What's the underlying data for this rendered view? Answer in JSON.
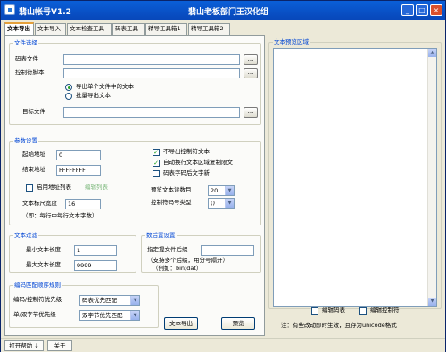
{
  "window": {
    "title": "翡山帐号V1.2",
    "subtitle": "翡山老板部门王汉化组"
  },
  "tabs": [
    {
      "label": "文本导出"
    },
    {
      "label": "文本导入"
    },
    {
      "label": "文本检查工具"
    },
    {
      "label": "码表工具"
    },
    {
      "label": "精导工具箱1"
    },
    {
      "label": "精导工具箱2"
    }
  ],
  "text_select": {
    "legend": "文件选择",
    "codetable_label": "码表文件",
    "codetable_value": "",
    "control_label": "控制符脚本",
    "control_value": "",
    "radio_single": "导出单个文件中的文本",
    "radio_batch": "批量导出文本",
    "target_label": "目标文件",
    "target_value": "",
    "browse": "..."
  },
  "params": {
    "legend": "参数设置",
    "start_label": "起始地址",
    "start_value": "0",
    "end_label": "结束地址",
    "end_value": "FFFFFFFF",
    "addr_list_label": "启用地址列表",
    "addr_list_link": "编辑列表",
    "max_len_label": "文本标尺宽度",
    "max_len_value": "16",
    "max_len_note": "（即：每行中每行文本字数）",
    "chk_control_label": "不导出控制符文本",
    "chk_control_checked": true,
    "chk_autowrap_label": "自动换行文本区域复制限文",
    "chk_autowrap_checked": true,
    "chk_encoding_label": "码表字码后文字新",
    "chk_encoding_checked": false,
    "preview_count_label": "预览文本读数目",
    "preview_count_value": "20",
    "control_type_label": "控制符码号类型",
    "control_type_value": "()"
  },
  "text_filter": {
    "legend": "文本过滤",
    "min_len_label": "最小文本长度",
    "min_len_value": "1",
    "max_len_label": "最大文本长度",
    "max_len_value": "9999"
  },
  "postprocess": {
    "legend": "数后置设置",
    "ext_label": "指定提文件后缀",
    "ext_value": "",
    "ext_hint": "（支持多个后缀，用分号隔开）",
    "ext_example": "（例如：bin;dat）"
  },
  "priority": {
    "legend": "编码匹配顺序规则",
    "row1_label": "编码/控制符优先级",
    "row1_value": "码表优先匹配",
    "row2_label": "单/双字节优先级",
    "row2_value": "双字节优先匹配"
  },
  "actions": {
    "export": "文本导出",
    "preview": "预览"
  },
  "right": {
    "legend": "文本预览区域",
    "chk_edit_codetable": "编辑码表",
    "chk_edit_control": "编辑控制符",
    "note": "注：有些改动即时生效，且存为unicode格式"
  },
  "statusbar": {
    "help": "打开帮助 ↓",
    "about": "关于"
  }
}
